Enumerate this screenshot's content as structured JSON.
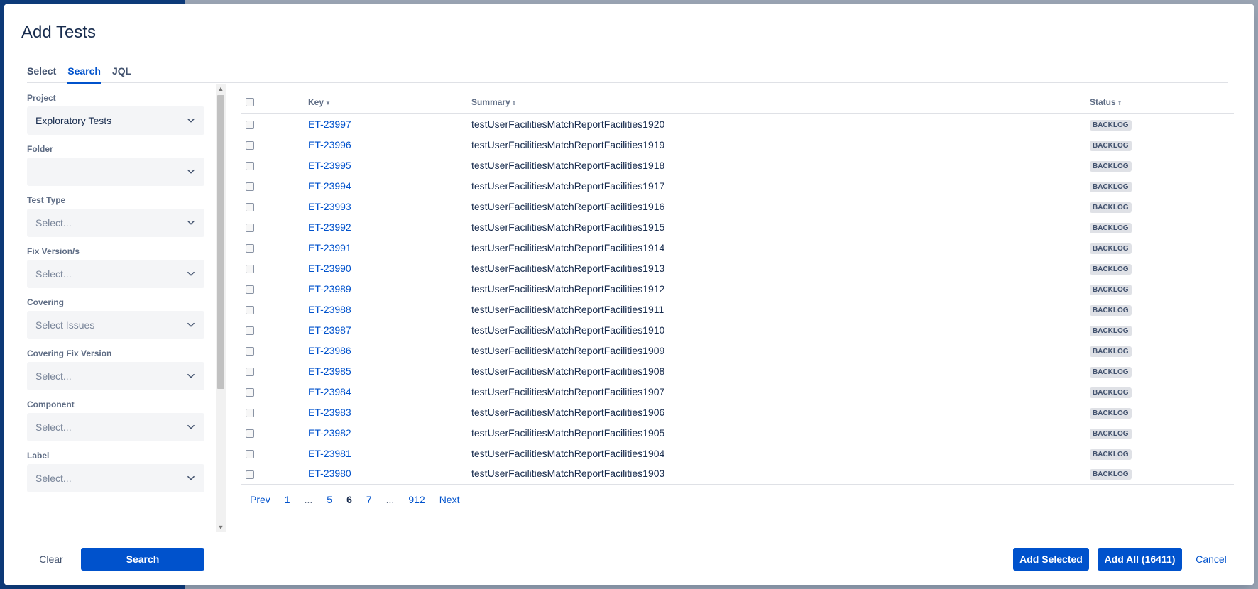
{
  "dialog": {
    "title": "Add Tests",
    "tabs": [
      {
        "label": "Select",
        "active": false
      },
      {
        "label": "Search",
        "active": true
      },
      {
        "label": "JQL",
        "active": false
      }
    ]
  },
  "filters": [
    {
      "label": "Project",
      "value": "Exploratory Tests",
      "placeholder": ""
    },
    {
      "label": "Folder",
      "value": "",
      "placeholder": ""
    },
    {
      "label": "Test Type",
      "value": "",
      "placeholder": "Select..."
    },
    {
      "label": "Fix Version/s",
      "value": "",
      "placeholder": "Select..."
    },
    {
      "label": "Covering",
      "value": "",
      "placeholder": "Select Issues"
    },
    {
      "label": "Covering Fix Version",
      "value": "",
      "placeholder": "Select..."
    },
    {
      "label": "Component",
      "value": "",
      "placeholder": "Select..."
    },
    {
      "label": "Label",
      "value": "",
      "placeholder": "Select..."
    }
  ],
  "table": {
    "columns": {
      "key": "Key",
      "summary": "Summary",
      "status": "Status"
    },
    "rows": [
      {
        "key": "ET-23997",
        "summary": "testUserFacilitiesMatchReportFacilities1920",
        "status": "BACKLOG"
      },
      {
        "key": "ET-23996",
        "summary": "testUserFacilitiesMatchReportFacilities1919",
        "status": "BACKLOG"
      },
      {
        "key": "ET-23995",
        "summary": "testUserFacilitiesMatchReportFacilities1918",
        "status": "BACKLOG"
      },
      {
        "key": "ET-23994",
        "summary": "testUserFacilitiesMatchReportFacilities1917",
        "status": "BACKLOG"
      },
      {
        "key": "ET-23993",
        "summary": "testUserFacilitiesMatchReportFacilities1916",
        "status": "BACKLOG"
      },
      {
        "key": "ET-23992",
        "summary": "testUserFacilitiesMatchReportFacilities1915",
        "status": "BACKLOG"
      },
      {
        "key": "ET-23991",
        "summary": "testUserFacilitiesMatchReportFacilities1914",
        "status": "BACKLOG"
      },
      {
        "key": "ET-23990",
        "summary": "testUserFacilitiesMatchReportFacilities1913",
        "status": "BACKLOG"
      },
      {
        "key": "ET-23989",
        "summary": "testUserFacilitiesMatchReportFacilities1912",
        "status": "BACKLOG"
      },
      {
        "key": "ET-23988",
        "summary": "testUserFacilitiesMatchReportFacilities1911",
        "status": "BACKLOG"
      },
      {
        "key": "ET-23987",
        "summary": "testUserFacilitiesMatchReportFacilities1910",
        "status": "BACKLOG"
      },
      {
        "key": "ET-23986",
        "summary": "testUserFacilitiesMatchReportFacilities1909",
        "status": "BACKLOG"
      },
      {
        "key": "ET-23985",
        "summary": "testUserFacilitiesMatchReportFacilities1908",
        "status": "BACKLOG"
      },
      {
        "key": "ET-23984",
        "summary": "testUserFacilitiesMatchReportFacilities1907",
        "status": "BACKLOG"
      },
      {
        "key": "ET-23983",
        "summary": "testUserFacilitiesMatchReportFacilities1906",
        "status": "BACKLOG"
      },
      {
        "key": "ET-23982",
        "summary": "testUserFacilitiesMatchReportFacilities1905",
        "status": "BACKLOG"
      },
      {
        "key": "ET-23981",
        "summary": "testUserFacilitiesMatchReportFacilities1904",
        "status": "BACKLOG"
      },
      {
        "key": "ET-23980",
        "summary": "testUserFacilitiesMatchReportFacilities1903",
        "status": "BACKLOG"
      }
    ]
  },
  "pagination": {
    "items": [
      {
        "label": "Prev",
        "type": "link"
      },
      {
        "label": "1",
        "type": "link"
      },
      {
        "label": "...",
        "type": "ellipsis"
      },
      {
        "label": "5",
        "type": "link"
      },
      {
        "label": "6",
        "type": "current"
      },
      {
        "label": "7",
        "type": "link"
      },
      {
        "label": "...",
        "type": "ellipsis"
      },
      {
        "label": "912",
        "type": "link"
      },
      {
        "label": "Next",
        "type": "link"
      }
    ]
  },
  "footer": {
    "clear_label": "Clear",
    "search_label": "Search",
    "add_selected_label": "Add Selected",
    "add_all_label": "Add All (16411)",
    "cancel_label": "Cancel"
  },
  "colors": {
    "primary": "#0052cc",
    "text": "#172b4d",
    "subtle": "#5e6c84",
    "lozenge_bg": "#dfe1e6"
  }
}
